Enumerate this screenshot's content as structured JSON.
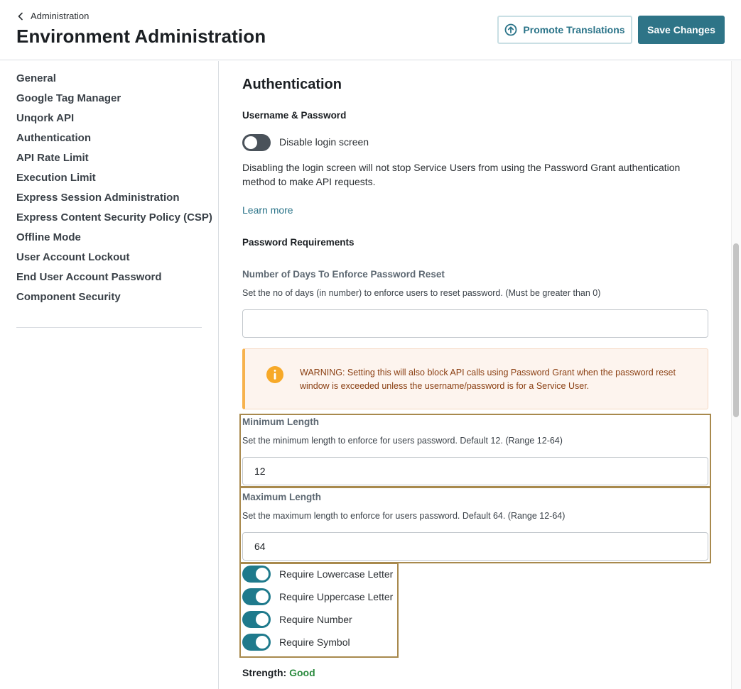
{
  "header": {
    "breadcrumb_label": "Administration",
    "title": "Environment Administration",
    "promote_label": "Promote Translations",
    "save_label": "Save Changes"
  },
  "sidebar": {
    "items": [
      {
        "label": "General"
      },
      {
        "label": "Google Tag Manager"
      },
      {
        "label": "Unqork API"
      },
      {
        "label": "Authentication"
      },
      {
        "label": "API Rate Limit"
      },
      {
        "label": "Execution Limit"
      },
      {
        "label": "Express Session Administration"
      },
      {
        "label": "Express Content Security Policy (CSP)"
      },
      {
        "label": "Offline Mode"
      },
      {
        "label": "User Account Lockout"
      },
      {
        "label": "End User Account Password"
      },
      {
        "label": "Component Security"
      }
    ]
  },
  "main": {
    "section_title": "Authentication",
    "username_password_title": "Username & Password",
    "disable_login": {
      "label": "Disable login screen",
      "enabled": false
    },
    "disable_login_note": "Disabling the login screen will not stop Service Users from using the Password Grant authentication method to make API requests.",
    "learn_more": "Learn more",
    "password_requirements_title": "Password Requirements",
    "reset_days": {
      "label": "Number of Days To Enforce Password Reset",
      "description": "Set the no of days (in number) to enforce users to reset password. (Must be greater than 0)",
      "value": ""
    },
    "warning_text": "WARNING: Setting this will also block API calls using Password Grant when the password reset window is exceeded unless the username/password is for a Service User.",
    "min_length": {
      "label": "Minimum Length",
      "description": "Set the minimum length to enforce for users password. Default 12. (Range 12-64)",
      "value": "12"
    },
    "max_length": {
      "label": "Maximum Length",
      "description": "Set the maximum length to enforce for users password. Default 64. (Range 12-64)",
      "value": "64"
    },
    "toggles": [
      {
        "label": "Require Lowercase Letter",
        "enabled": true
      },
      {
        "label": "Require Uppercase Letter",
        "enabled": true
      },
      {
        "label": "Require Number",
        "enabled": true
      },
      {
        "label": "Require Symbol",
        "enabled": true
      }
    ],
    "strength_label": "Strength:",
    "strength_value": "Good"
  },
  "colors": {
    "primary": "#2e7487",
    "toggle_on": "#1f7a8c",
    "toggle_off": "#4a525a",
    "warning_accent": "#f7b24d",
    "warning_text": "#8a3f12",
    "strength_good": "#2a8a3e",
    "highlight_outline": "#a8894d"
  }
}
